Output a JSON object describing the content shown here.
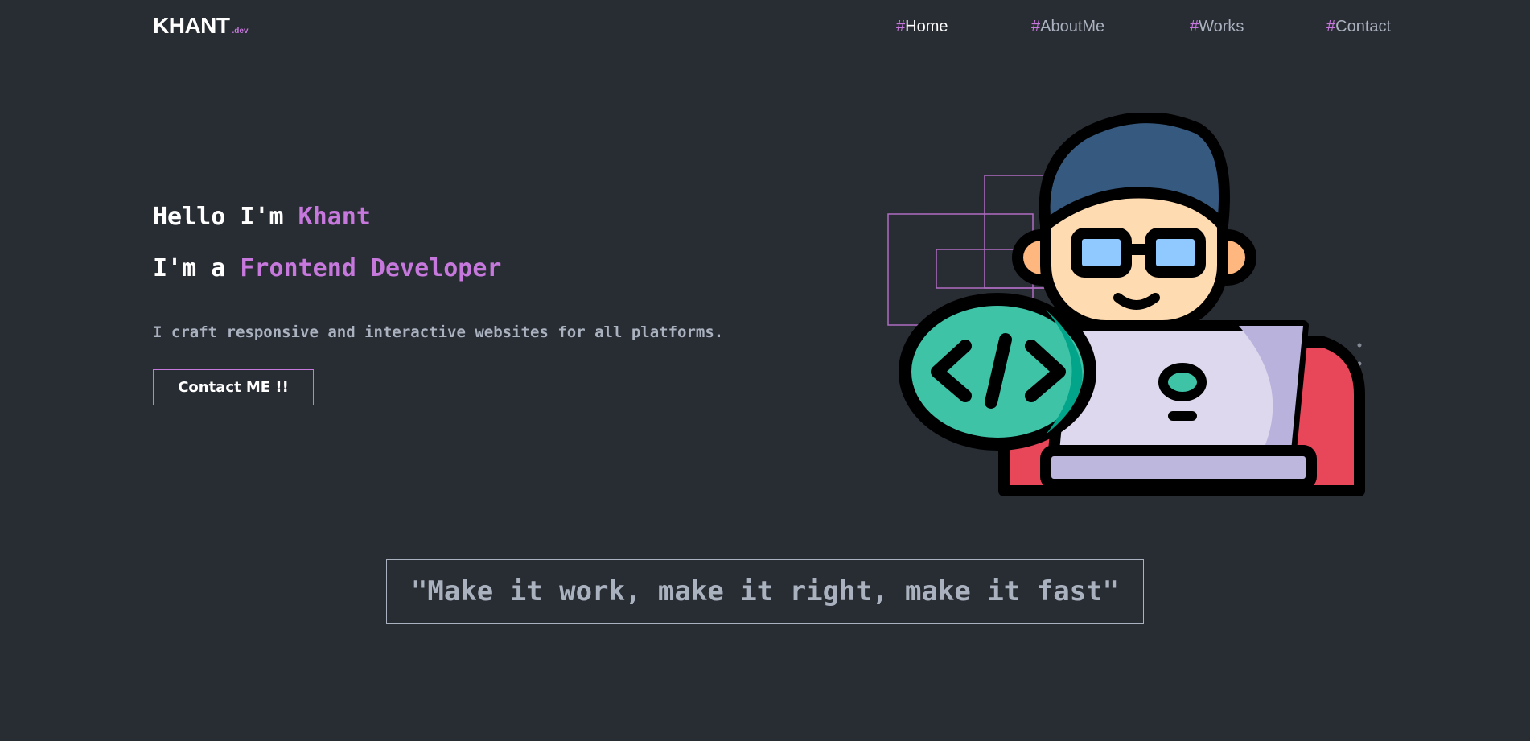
{
  "brand": {
    "name": "KHANT",
    "suffix": ".dev",
    "accent_color": "#c778dd"
  },
  "nav": {
    "items": [
      {
        "hash": "#",
        "label": "Home",
        "active": true
      },
      {
        "hash": "#",
        "label": "AboutMe",
        "active": false
      },
      {
        "hash": "#",
        "label": "Works",
        "active": false
      },
      {
        "hash": "#",
        "label": "Contact",
        "active": false
      }
    ]
  },
  "hero": {
    "line1_prefix": "Hello I'm ",
    "line1_name": "Khant",
    "line2_prefix": "I'm a ",
    "line2_role": "Frontend Developer",
    "description": "I craft responsive and interactive websites for all platforms.",
    "cta_label": "Contact ME !!",
    "illustration_icon": "developer-with-laptop-illustration"
  },
  "quote": {
    "text": "\"Make it work, make it right, make it fast\""
  },
  "theme": {
    "background": "#282c33",
    "text_primary": "#ffffff",
    "text_secondary": "#abb2bf",
    "accent": "#c778dd"
  }
}
